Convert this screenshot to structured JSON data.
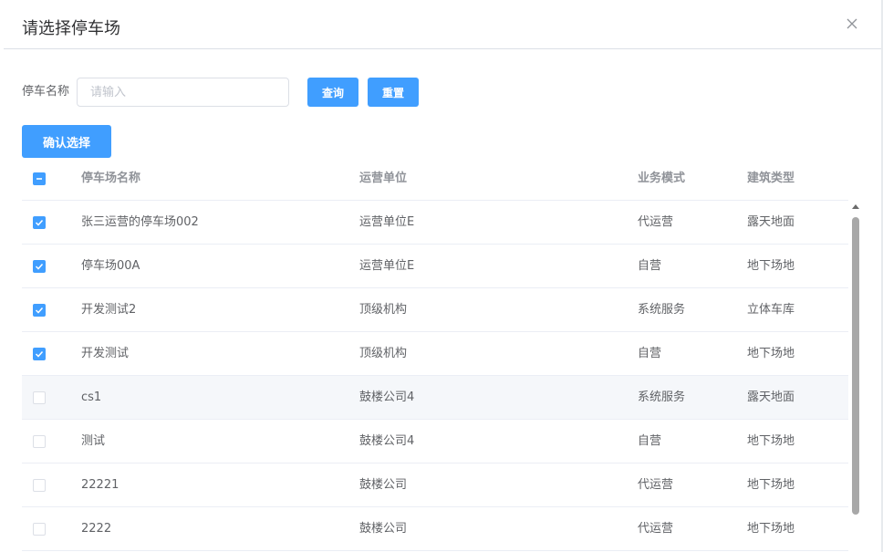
{
  "dialog": {
    "title": "请选择停车场",
    "close_icon": "close-icon"
  },
  "search": {
    "label": "停车名称",
    "placeholder": "请输入",
    "value": "",
    "query_label": "查询",
    "reset_label": "重置"
  },
  "confirm_label": "确认选择",
  "table": {
    "header": {
      "select_all_state": "indeterminate",
      "name": "停车场名称",
      "unit": "运营单位",
      "mode": "业务模式",
      "type": "建筑类型"
    },
    "rows": [
      {
        "checked": true,
        "name": "张三运营的停车场002",
        "unit": "运营单位E",
        "mode": "代运营",
        "type": "露天地面"
      },
      {
        "checked": true,
        "name": "停车场00A",
        "unit": "运营单位E",
        "mode": "自营",
        "type": "地下场地"
      },
      {
        "checked": true,
        "name": "开发测试2",
        "unit": "顶级机构",
        "mode": "系统服务",
        "type": "立体车库"
      },
      {
        "checked": true,
        "name": "开发测试",
        "unit": "顶级机构",
        "mode": "自营",
        "type": "地下场地"
      },
      {
        "checked": false,
        "name": "cs1",
        "unit": "鼓楼公司4",
        "mode": "系统服务",
        "type": "露天地面",
        "hover": true
      },
      {
        "checked": false,
        "name": "测试",
        "unit": "鼓楼公司4",
        "mode": "自营",
        "type": "地下场地"
      },
      {
        "checked": false,
        "name": "22221",
        "unit": "鼓楼公司",
        "mode": "代运营",
        "type": "地下场地"
      },
      {
        "checked": false,
        "name": "2222",
        "unit": "鼓楼公司",
        "mode": "代运营",
        "type": "地下场地"
      }
    ]
  },
  "colors": {
    "primary": "#409eff",
    "header_text": "#909399",
    "body_text": "#606266",
    "border": "#ebeef5"
  }
}
